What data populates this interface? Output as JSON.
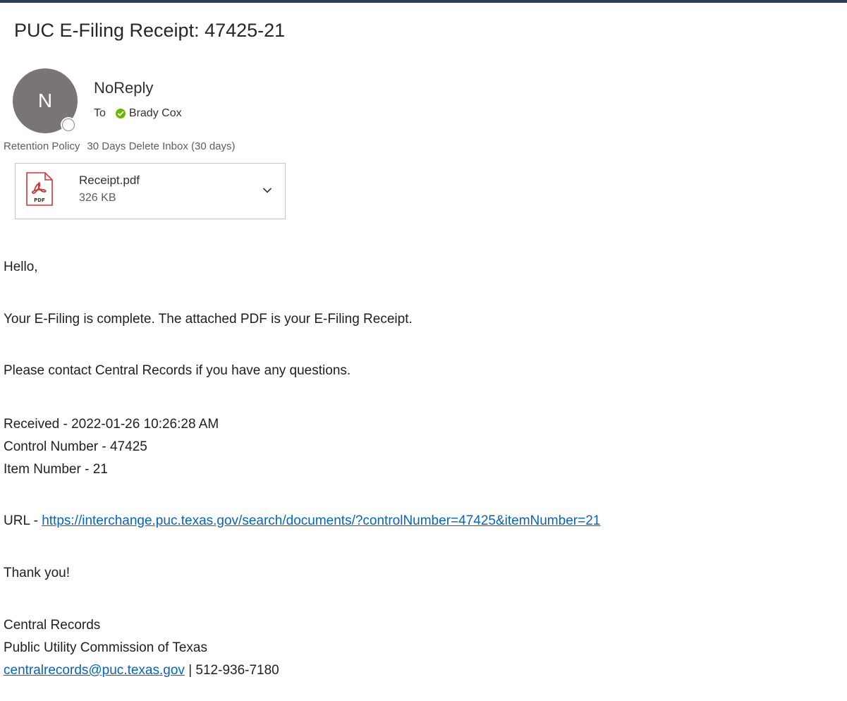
{
  "email": {
    "subject": "PUC E-Filing Receipt: 47425-21",
    "sender_initial": "N",
    "sender_name": "NoReply",
    "to_label": "To",
    "recipient": "Brady Cox",
    "retention_label": "Retention Policy",
    "retention_value": "30 Days Delete Inbox (30 days)",
    "attachment": {
      "name": "Receipt.pdf",
      "size": "326 KB",
      "icon": "pdf-icon",
      "icon_text": "PDF"
    }
  },
  "body": {
    "greeting": "Hello,",
    "line1": "Your E-Filing is complete. The attached PDF is your E-Filing Receipt.",
    "line2": "Please contact Central Records if you have any questions.",
    "received": "Received - 2022-01-26 10:26:28 AM",
    "control": "Control Number - 47425",
    "item": "Item Number - 21",
    "url_prefix": "URL - ",
    "url": "https://interchange.puc.texas.gov/search/documents/?controlNumber=47425&itemNumber=21",
    "thanks": "Thank you!",
    "sig_name": "Central Records",
    "sig_org": "Public Utility Commission of Texas",
    "sig_email": "centralrecords@puc.texas.gov",
    "sig_phone": " | 512-936-7180"
  },
  "colors": {
    "link": "#0563c1",
    "avatar": "#7a7574",
    "presence_ok": "#6bb700",
    "pdf_red": "#d13438",
    "header_bar": "#2b3f5c"
  }
}
